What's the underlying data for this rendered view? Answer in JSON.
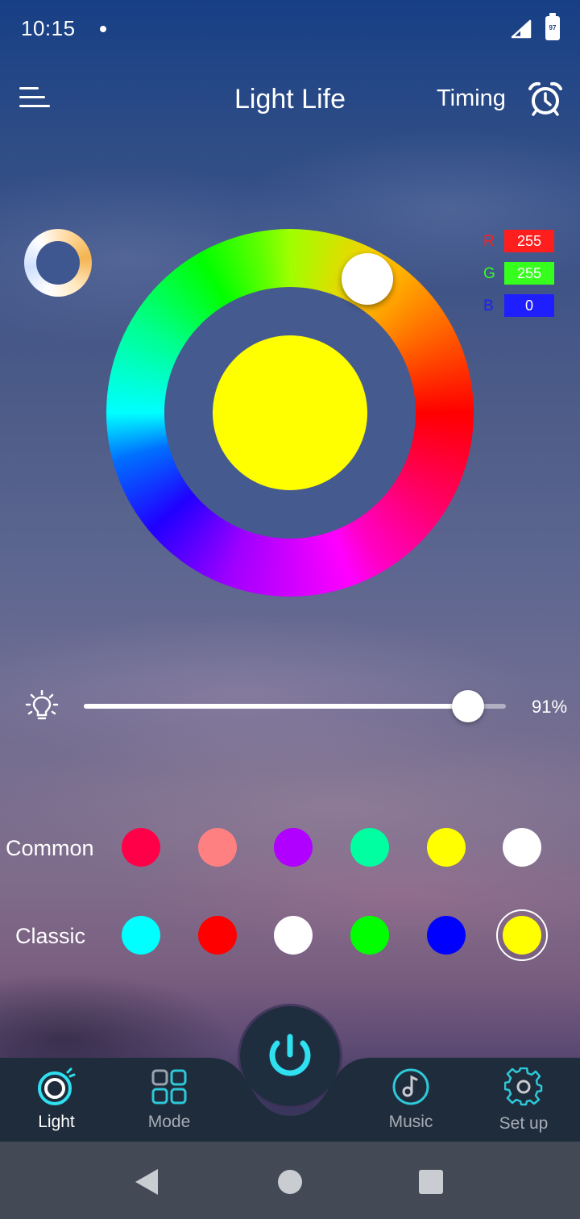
{
  "status_bar": {
    "time": "10:15",
    "battery_level": "97"
  },
  "header": {
    "title": "Light Life",
    "timing_label": "Timing"
  },
  "color_picker": {
    "preview_color": "#ffff00",
    "rgb": [
      {
        "letter": "R",
        "value": "255",
        "letter_color": "#ff1e1e",
        "box_color": "#ff1e1e"
      },
      {
        "letter": "G",
        "value": "255",
        "letter_color": "#36ff1e",
        "box_color": "#36ff1e"
      },
      {
        "letter": "B",
        "value": "0",
        "letter_color": "#1e1eff",
        "box_color": "#1e1eff"
      }
    ]
  },
  "brightness": {
    "value_label": "91%",
    "level": 0.91
  },
  "swatches": {
    "common_label": "Common",
    "common_colors": [
      "#ff0048",
      "#ff8080",
      "#b000ff",
      "#00ffa0",
      "#ffff00",
      "#ffffff"
    ],
    "classic_label": "Classic",
    "classic_colors": [
      "#00ffff",
      "#ff0000",
      "#ffffff",
      "#00ff00",
      "#0000ff",
      "#ffff00"
    ],
    "classic_selected_index": 5
  },
  "bottom_nav": {
    "items": [
      {
        "label": "Light",
        "icon": "light-icon",
        "active": true
      },
      {
        "label": "Mode",
        "icon": "mode-icon",
        "active": false
      },
      {
        "label": "Music",
        "icon": "music-icon",
        "active": false
      },
      {
        "label": "Set up",
        "icon": "gear-icon",
        "active": false
      }
    ],
    "accent_color": "#2ee0f0"
  }
}
